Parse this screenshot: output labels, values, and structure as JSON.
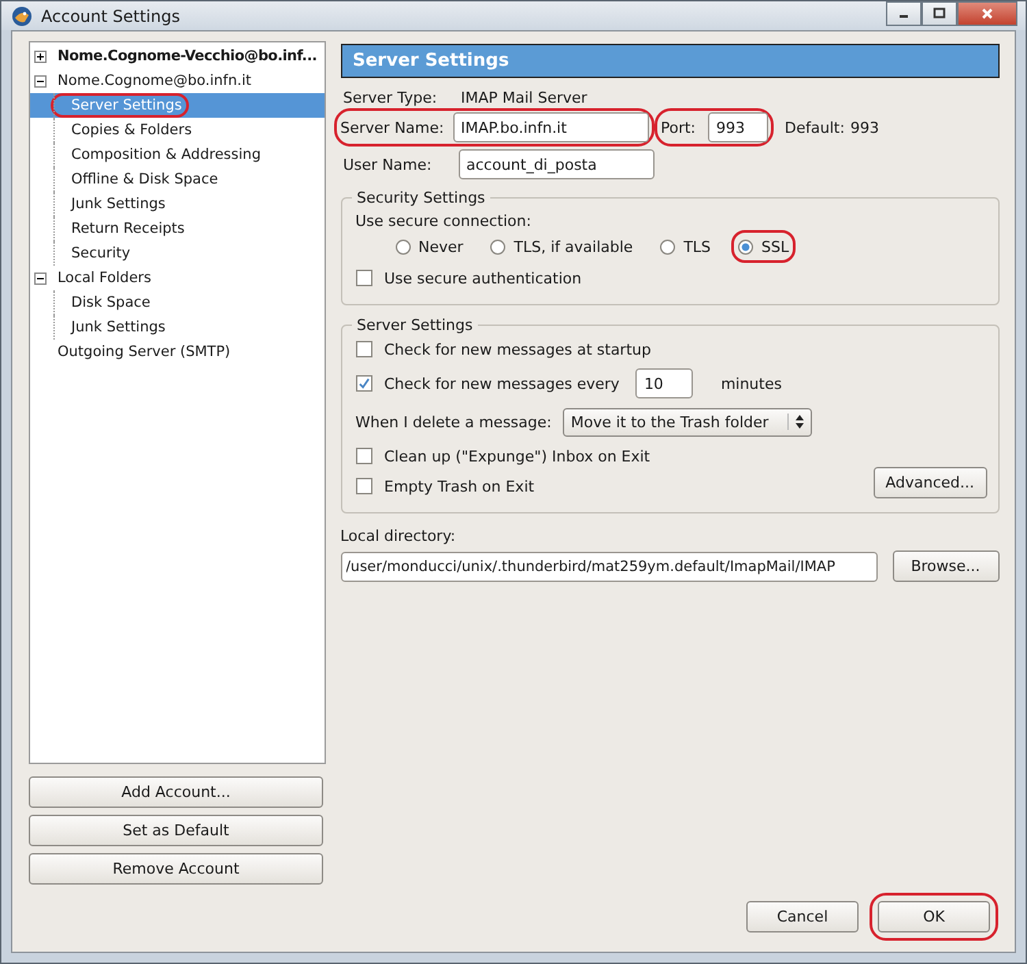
{
  "window": {
    "title": "Account Settings"
  },
  "tree": [
    {
      "label": "Nome.Cognome-Vecchio@bo.inf...",
      "bold": true,
      "expanded": false,
      "selected": false,
      "highlighted": false
    },
    {
      "label": "Nome.Cognome@bo.infn.it",
      "bold": false,
      "expanded": true,
      "selected": false,
      "highlighted": false,
      "children": [
        {
          "label": "Server Settings",
          "selected": true,
          "highlighted": true
        },
        {
          "label": "Copies & Folders",
          "selected": false,
          "highlighted": false
        },
        {
          "label": "Composition & Addressing",
          "selected": false,
          "highlighted": false
        },
        {
          "label": "Offline & Disk Space",
          "selected": false,
          "highlighted": false
        },
        {
          "label": "Junk Settings",
          "selected": false,
          "highlighted": false
        },
        {
          "label": "Return Receipts",
          "selected": false,
          "highlighted": false
        },
        {
          "label": "Security",
          "selected": false,
          "highlighted": false
        }
      ]
    },
    {
      "label": "Local Folders",
      "bold": false,
      "expanded": true,
      "selected": false,
      "highlighted": false,
      "children": [
        {
          "label": "Disk Space",
          "selected": false,
          "highlighted": false
        },
        {
          "label": "Junk Settings",
          "selected": false,
          "highlighted": false
        }
      ]
    },
    {
      "label": "Outgoing Server (SMTP)",
      "bold": false,
      "selected": false,
      "highlighted": false
    }
  ],
  "account_buttons": [
    "Add Account...",
    "Set as Default",
    "Remove Account"
  ],
  "panel": {
    "title": "Server Settings",
    "server_type": {
      "label": "Server Type:",
      "value": "IMAP Mail Server"
    },
    "server_name": {
      "label": "Server Name:",
      "value": "IMAP.bo.infn.it",
      "highlighted": true
    },
    "port": {
      "label": "Port:",
      "value": "993",
      "highlighted": true
    },
    "default": {
      "label": "Default:",
      "value": "993"
    },
    "user_name": {
      "label": "User Name:",
      "value": "account_di_posta"
    },
    "security": {
      "title": "Security Settings",
      "prompt": "Use secure connection:",
      "options": [
        {
          "label": "Never",
          "selected": false,
          "highlighted": false
        },
        {
          "label": "TLS, if available",
          "selected": false,
          "highlighted": false
        },
        {
          "label": "TLS",
          "selected": false,
          "highlighted": false
        },
        {
          "label": "SSL",
          "selected": true,
          "highlighted": true
        }
      ],
      "secure_auth": {
        "label": "Use secure authentication",
        "checked": false
      }
    },
    "server_settings": {
      "title": "Server Settings",
      "check_startup": {
        "label": "Check for new messages at startup",
        "checked": false
      },
      "check_every": {
        "label": "Check for new messages every",
        "checked": true,
        "value": "10",
        "unit": "minutes"
      },
      "delete": {
        "label": "When I delete a message:",
        "value": "Move it to the Trash folder"
      },
      "cleanup": {
        "label": "Clean up (\"Expunge\") Inbox on Exit",
        "checked": false
      },
      "empty_trash": {
        "label": "Empty Trash on Exit",
        "checked": false
      },
      "advanced": "Advanced..."
    },
    "local_directory": {
      "label": "Local directory:",
      "value": "/user/monducci/unix/.thunderbird/mat259ym.default/ImapMail/IMAP",
      "browse": "Browse..."
    }
  },
  "dialog_buttons": [
    {
      "label": "Cancel",
      "highlighted": false
    },
    {
      "label": "OK",
      "highlighted": true
    }
  ]
}
